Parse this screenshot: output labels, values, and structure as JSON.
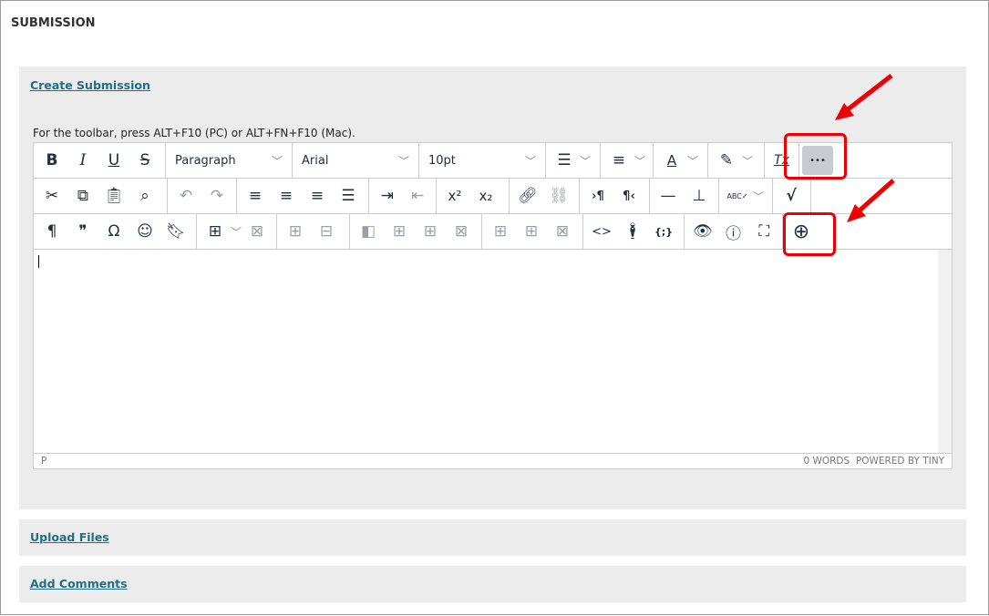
{
  "section_title": "SUBMISSION",
  "create_submission": "Create Submission",
  "toolbar_hint": "For the toolbar, press ALT+F10 (PC) or ALT+FN+F10 (Mac).",
  "toolbar": {
    "paragraph": "Paragraph",
    "font": "Arial",
    "size": "10pt",
    "more": "•••",
    "bold": "B",
    "italic": "I",
    "underline": "U",
    "strike": "S",
    "superscript": "x²",
    "subscript": "x₂",
    "ltr": "›¶",
    "rtl": "¶‹",
    "spell": "ABC✓",
    "pilcrow": "¶",
    "quote": "❞",
    "omega": "Ω",
    "code": "<>",
    "codesample": "{;}",
    "clear": "Tx"
  },
  "status": {
    "path": "P",
    "words": "0 WORDS",
    "powered": "POWERED BY TINY"
  },
  "upload_files": "Upload Files",
  "add_comments": "Add Comments",
  "colors": {
    "link": "#1f6f8b",
    "annotation": "#e00000",
    "more_bg": "#c8cbcf"
  }
}
